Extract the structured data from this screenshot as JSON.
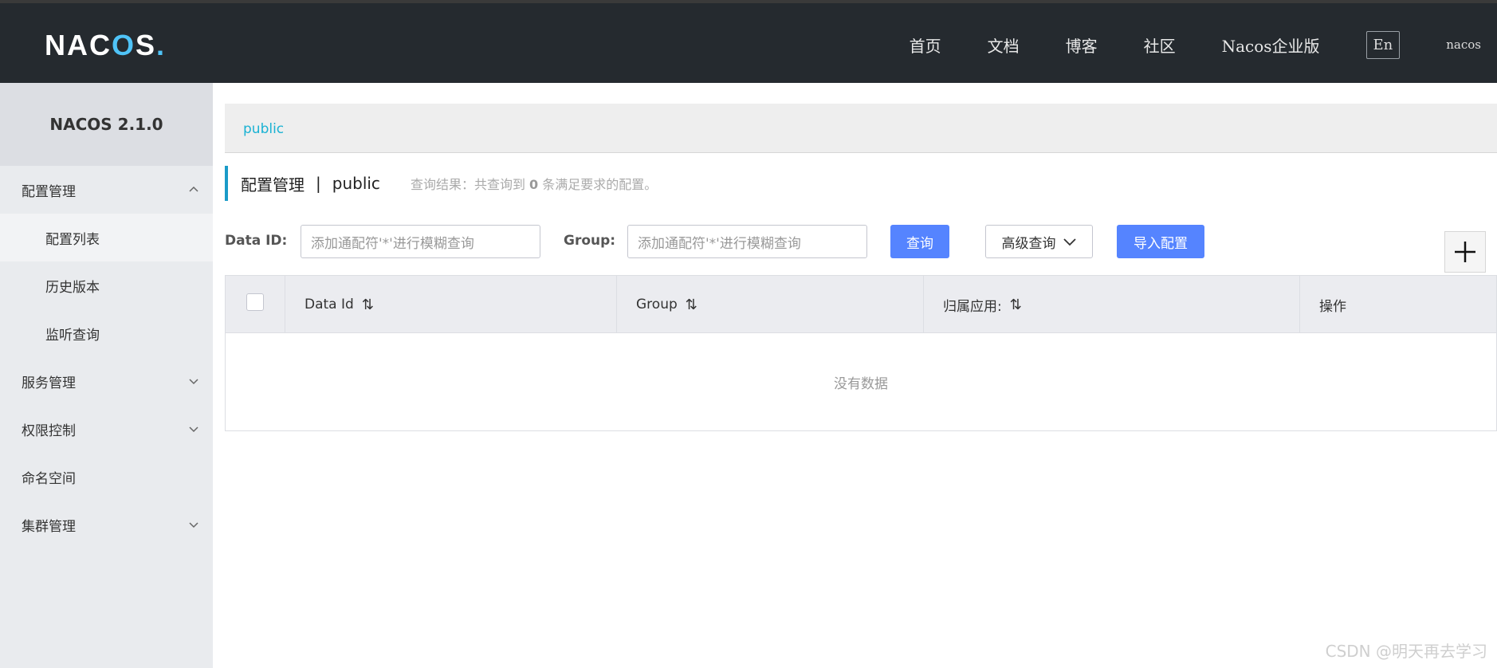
{
  "header": {
    "logo_parts": [
      "N",
      "A",
      "C",
      "O",
      "S",
      "."
    ],
    "nav": [
      "首页",
      "文档",
      "博客",
      "社区",
      "Nacos企业版"
    ],
    "lang_toggle": "En",
    "user": "nacos"
  },
  "sidebar": {
    "version_title": "NACOS 2.1.0",
    "items": [
      {
        "label": "配置管理",
        "expanded": true
      },
      {
        "label": "配置列表",
        "sub": true,
        "active": true
      },
      {
        "label": "历史版本",
        "sub": true
      },
      {
        "label": "监听查询",
        "sub": true
      },
      {
        "label": "服务管理",
        "expanded": false
      },
      {
        "label": "权限控制",
        "expanded": false
      },
      {
        "label": "命名空间"
      },
      {
        "label": "集群管理",
        "expanded": false
      }
    ]
  },
  "namespace_bar": {
    "current": "public"
  },
  "page_header": {
    "title": "配置管理",
    "separator": "|",
    "namespace": "public",
    "result_prefix": "查询结果：共查询到",
    "result_count": "0",
    "result_suffix": "条满足要求的配置。"
  },
  "filters": {
    "data_id_label": "Data ID:",
    "data_id_placeholder": "添加通配符'*'进行模糊查询",
    "group_label": "Group:",
    "group_placeholder": "添加通配符'*'进行模糊查询",
    "query_button": "查询",
    "advanced_query_button": "高级查询",
    "import_button": "导入配置"
  },
  "table": {
    "columns": [
      "Data Id",
      "Group",
      "归属应用:",
      "操作"
    ],
    "sort_glyph": "⇅",
    "empty_text": "没有数据"
  },
  "watermark": "CSDN @明天再去学习",
  "colors": {
    "topbar_bg": "#252a2f",
    "accent_blue": "#5584ff",
    "link_cyan": "#1ab2d3",
    "sidebar_bg": "#e9ebee"
  }
}
